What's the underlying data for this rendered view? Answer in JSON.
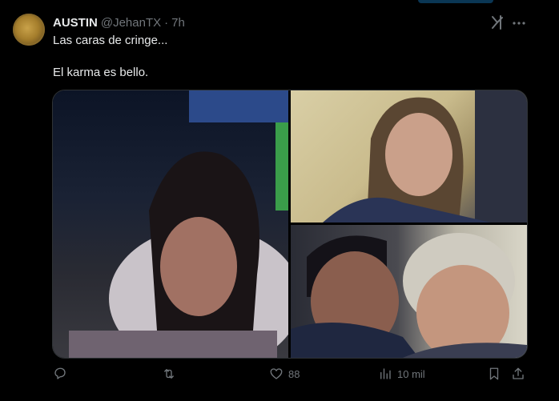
{
  "tweet": {
    "author_name": "AUSTIN",
    "handle": "@JehanTX",
    "separator": "·",
    "time": "7h",
    "text_line1": "Las caras de cringe...",
    "text_line2": "El karma es bello."
  },
  "actions": {
    "likes": "88",
    "views": "10 mil"
  },
  "colors": {
    "background": "#000000",
    "text": "#e7e9ea",
    "muted": "#71767b"
  },
  "icons": [
    "grok-icon",
    "more-icon",
    "reply-icon",
    "retweet-icon",
    "like-icon",
    "views-icon",
    "bookmark-icon",
    "share-icon"
  ]
}
